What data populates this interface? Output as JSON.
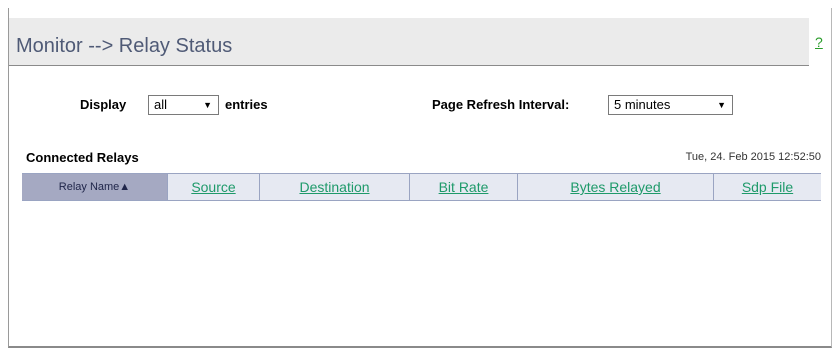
{
  "page": {
    "title": "Monitor --> Relay Status",
    "help_label": "?"
  },
  "controls": {
    "display_label": "Display",
    "display_value": "all",
    "entries_label": "entries",
    "refresh_label": "Page Refresh Interval:",
    "refresh_value": "5 minutes",
    "dropdown_arrow": "▼"
  },
  "relays": {
    "section_title": "Connected Relays",
    "timestamp": "Tue, 24. Feb 2015 12:52:50",
    "columns": [
      {
        "label": "Relay Name▲",
        "sorted": true
      },
      {
        "label": "Source"
      },
      {
        "label": "Destination"
      },
      {
        "label": "Bit Rate"
      },
      {
        "label": "Bytes Relayed"
      },
      {
        "label": "Sdp File"
      }
    ],
    "rows": []
  }
}
